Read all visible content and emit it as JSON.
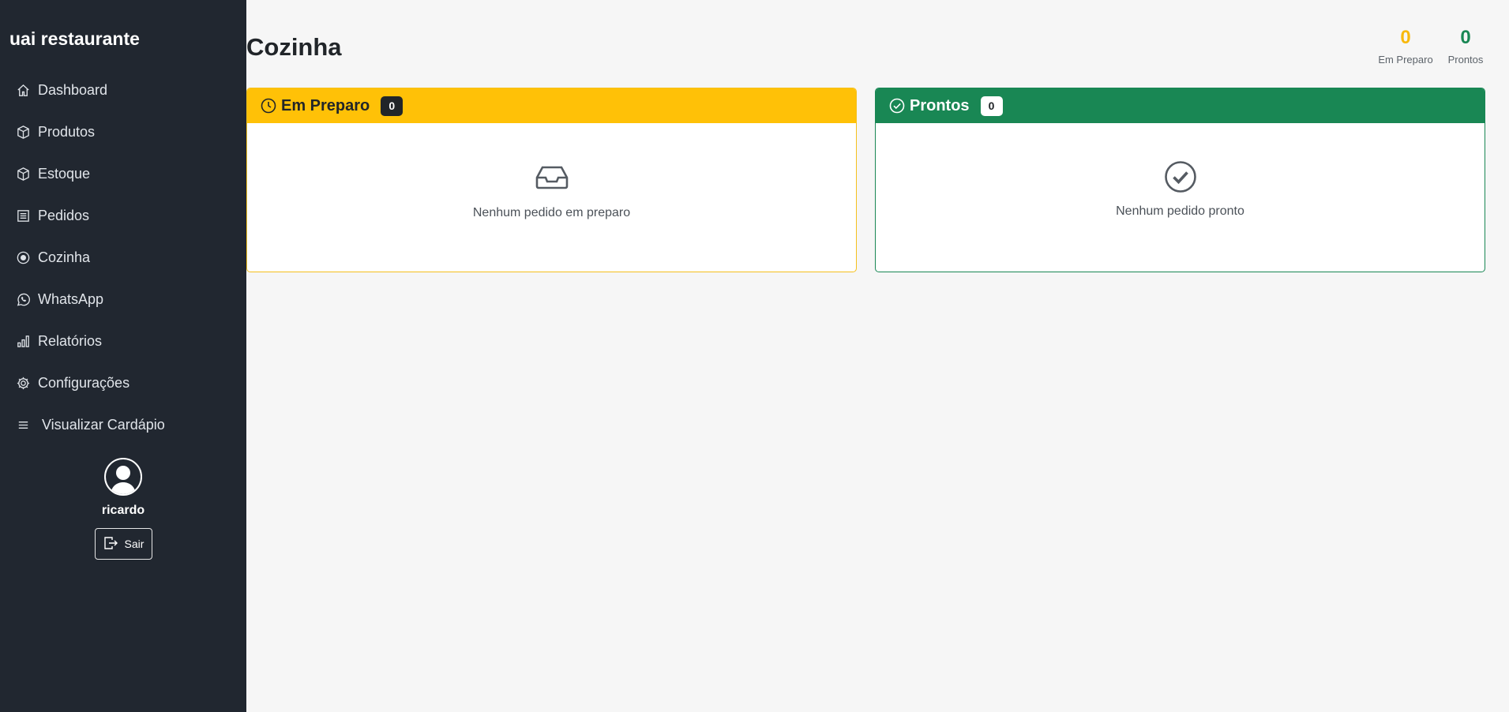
{
  "brand": "uai restaurante",
  "nav": [
    {
      "label": "Dashboard",
      "icon": "house-icon"
    },
    {
      "label": "Produtos",
      "icon": "box-icon"
    },
    {
      "label": "Estoque",
      "icon": "box-icon"
    },
    {
      "label": "Pedidos",
      "icon": "receipt-icon"
    },
    {
      "label": "Cozinha",
      "icon": "cooking-icon"
    },
    {
      "label": "WhatsApp",
      "icon": "whatsapp-icon"
    },
    {
      "label": "Relatórios",
      "icon": "bar-chart-icon"
    },
    {
      "label": "Configurações",
      "icon": "gear-icon"
    },
    {
      "label": "Visualizar Cardápio",
      "icon": "list-icon"
    }
  ],
  "user": {
    "name": "ricardo",
    "logout_label": "Sair"
  },
  "page": {
    "title": "Cozinha"
  },
  "stats": {
    "prep": {
      "value": "0",
      "label": "Em Preparo",
      "color": "#f8b90d"
    },
    "ready": {
      "value": "0",
      "label": "Prontos",
      "color": "#198754"
    }
  },
  "columns": {
    "prep": {
      "title": "Em Preparo",
      "count": "0",
      "empty": "Nenhum pedido em preparo",
      "color": "#ffc107"
    },
    "ready": {
      "title": "Prontos",
      "count": "0",
      "empty": "Nenhum pedido pronto",
      "color": "#198754"
    }
  }
}
